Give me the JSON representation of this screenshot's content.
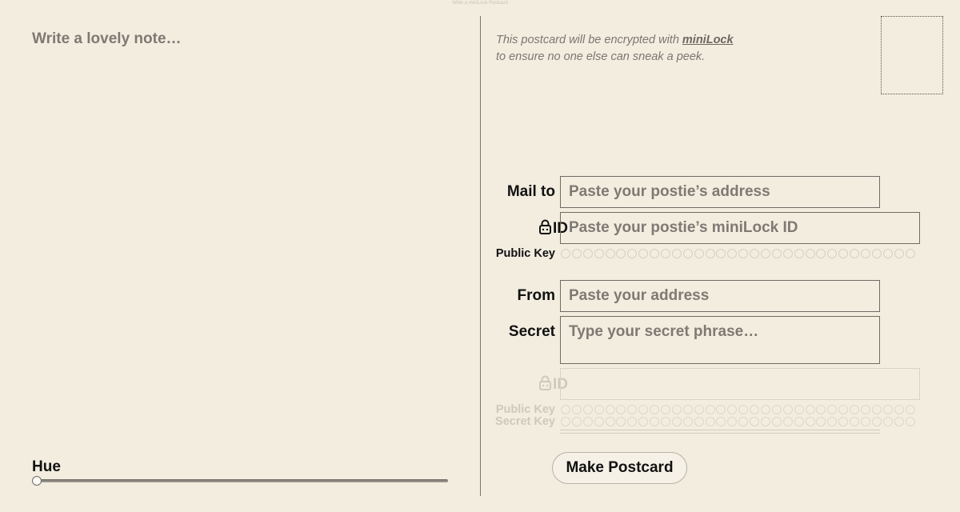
{
  "page": {
    "caption": "Write a miniLock Postcard"
  },
  "note": {
    "placeholder": "Write a lovely note…"
  },
  "hue": {
    "label": "Hue",
    "value": 0
  },
  "notice": {
    "line1_prefix": "This postcard will be encrypted with ",
    "link": "miniLock",
    "line2": "to ensure no one else can sneak a peek."
  },
  "recipient": {
    "mail_to_label": "Mail to",
    "mail_to_placeholder": "Paste your postie’s address",
    "id_label": "ID",
    "id_placeholder": "Paste your postie’s miniLock ID",
    "public_key_label": "Public Key"
  },
  "sender": {
    "from_label": "From",
    "from_placeholder": "Paste your address",
    "secret_label": "Secret",
    "secret_placeholder": "Type your secret phrase…",
    "id_label": "ID",
    "public_key_label": "Public Key",
    "secret_key_label": "Secret Key"
  },
  "actions": {
    "make_postcard": "Make Postcard"
  },
  "icons": {
    "lock": "lock-icon"
  },
  "colors": {
    "background": "#f3ede0",
    "border": "#6f6b64",
    "placeholder": "#7e7a73",
    "faded": "#cfc9bd"
  }
}
